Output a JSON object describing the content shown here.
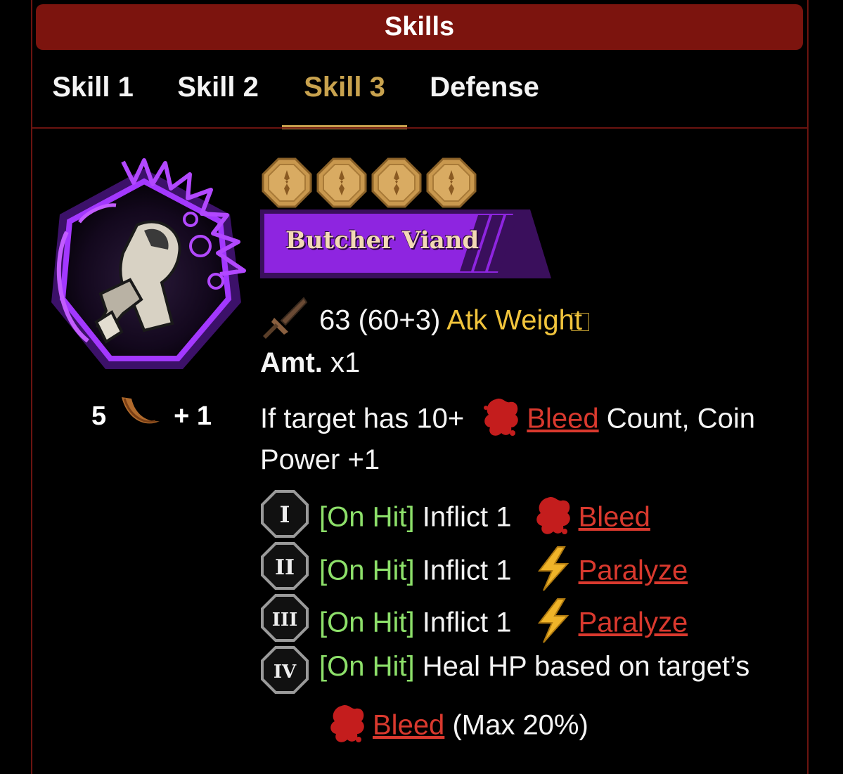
{
  "header": {
    "title": "Skills"
  },
  "tabs": [
    {
      "label": "Skill 1",
      "active": false
    },
    {
      "label": "Skill 2",
      "active": false
    },
    {
      "label": "Skill 3",
      "active": true
    },
    {
      "label": "Defense",
      "active": false
    }
  ],
  "skill": {
    "name": "Butcher Viand",
    "coin_count": 4,
    "cost": {
      "base": "5",
      "bonus": "+ 1"
    },
    "attack": {
      "value": "63 (60+3)",
      "weight_label": "Atk Weight",
      "weight_glyph": "⃞"
    },
    "amount": {
      "label": "Amt.",
      "value": "x1"
    },
    "condition": {
      "prefix": "If target has 10+",
      "keyword": "Bleed",
      "suffix": "Count, Coin",
      "line2": "Power +1"
    },
    "coin_effects": [
      {
        "numeral": "I",
        "trigger": "[On Hit]",
        "text": "Inflict 1",
        "status": "Bleed",
        "icon": "bleed-icon"
      },
      {
        "numeral": "II",
        "trigger": "[On Hit]",
        "text": "Inflict 1",
        "status": "Paralyze",
        "icon": "paralyze-icon"
      },
      {
        "numeral": "III",
        "trigger": "[On Hit]",
        "text": "Inflict 1",
        "status": "Paralyze",
        "icon": "paralyze-icon"
      },
      {
        "numeral": "IV",
        "trigger": "[On Hit]",
        "text": "Heal HP based on target’s",
        "status": "Bleed",
        "tail": "(Max 20%)",
        "icon": "bleed-icon"
      }
    ]
  },
  "colors": {
    "header_bg": "#7c140e",
    "tab_active": "#c8a24e",
    "banner_purple": "#8e25e0",
    "keyword_gold": "#f1c43c",
    "trigger_green": "#8de06a",
    "status_red": "#d9392e"
  }
}
